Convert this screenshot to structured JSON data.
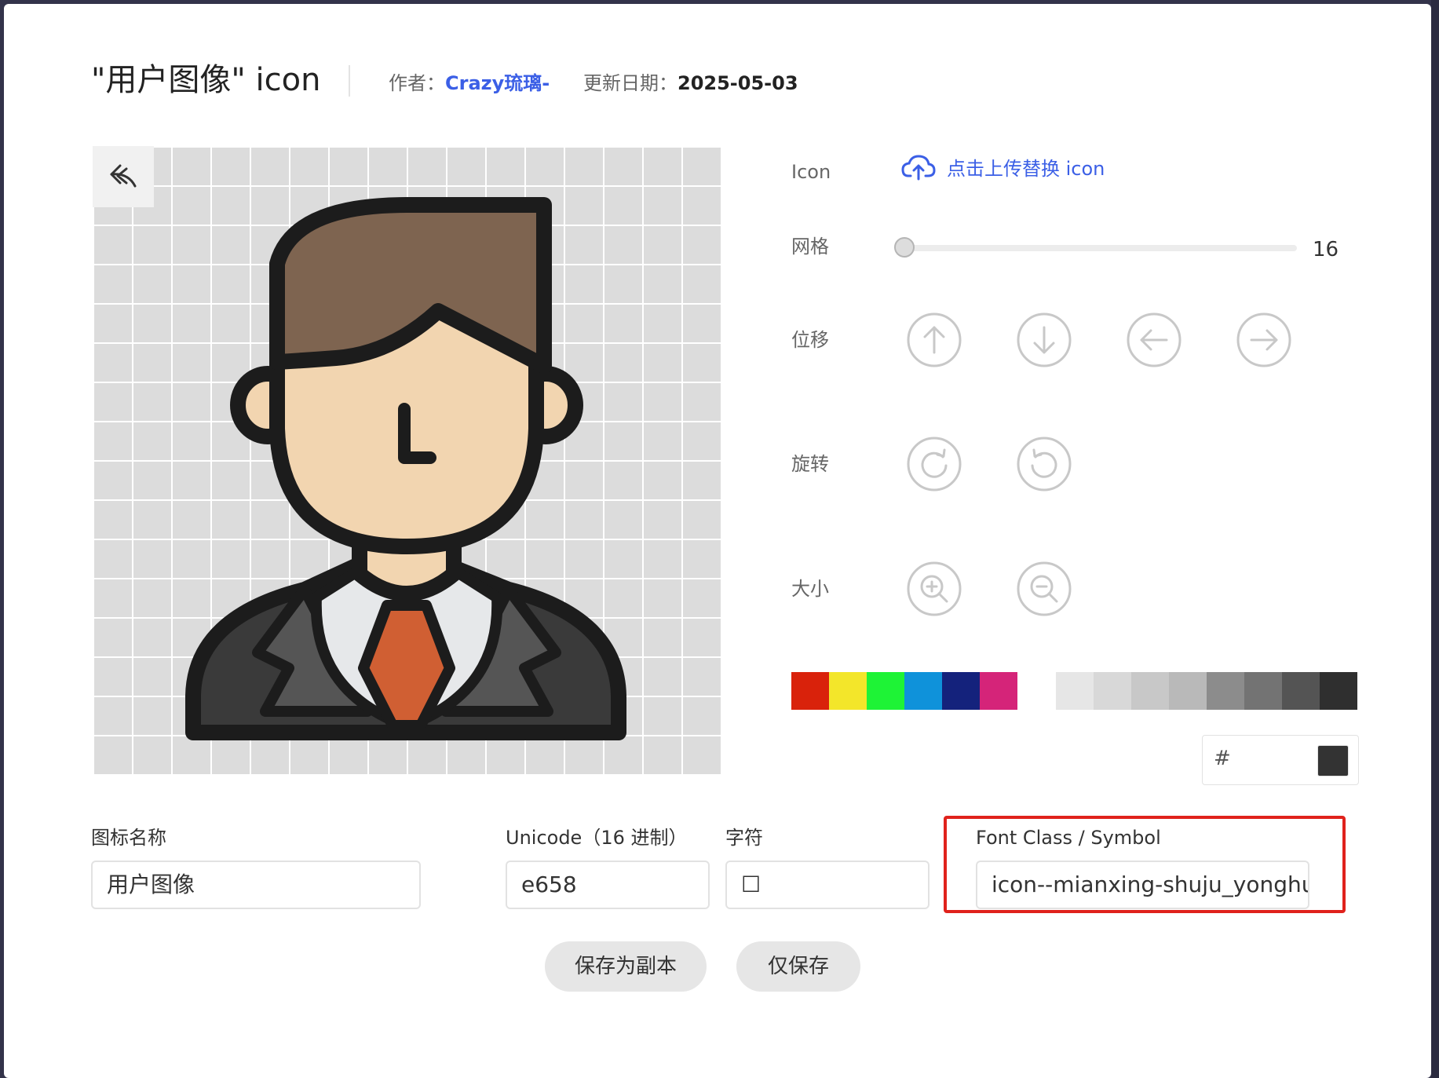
{
  "header": {
    "title": "\"用户图像\" icon",
    "author_label": "作者：",
    "author": "Crazy琉璃-",
    "date_label": "更新日期：",
    "date": "2025-05-03"
  },
  "controls": {
    "icon_label": "Icon",
    "upload_text": "点击上传替换 icon",
    "grid_label": "网格",
    "grid_value": "16",
    "grid_slider": {
      "min": 0,
      "max": 100,
      "value": 0
    },
    "move_label": "位移",
    "rotate_label": "旋转",
    "size_label": "大小",
    "hex_prefix": "#",
    "hex_preview_color": "#333333"
  },
  "swatches": {
    "colors": [
      "#d9220b",
      "#f3e62a",
      "#1ef336",
      "#0f92da",
      "#14227c",
      "#d52479"
    ],
    "grays": [
      "#e6e6e6",
      "#d8d8d8",
      "#c8c8c8",
      "#b9b9b9",
      "#8c8c8c",
      "#737373",
      "#545454",
      "#2f2f2f"
    ]
  },
  "fields": {
    "name_label": "图标名称",
    "name_value": "用户图像",
    "unicode_label": "Unicode（16 进制）",
    "unicode_value": "e658",
    "char_label": "字符",
    "char_value": "☐",
    "fontclass_label": "Font Class / Symbol",
    "fontclass_value": "icon--mianxing-shuju_yonghutu"
  },
  "actions": {
    "save_copy": "保存为副本",
    "save_only": "仅保存"
  },
  "icons": {
    "undo": "undo-arrow-icon",
    "upload": "cloud-upload-icon",
    "move": [
      "arrow-up-icon",
      "arrow-down-icon",
      "arrow-left-icon",
      "arrow-right-icon"
    ],
    "rotate": [
      "rotate-clockwise-icon",
      "rotate-counterclockwise-icon"
    ],
    "size": [
      "zoom-in-icon",
      "zoom-out-icon"
    ]
  },
  "colors": {
    "accent": "#3b5fe6",
    "highlight_border": "#e0221c"
  }
}
